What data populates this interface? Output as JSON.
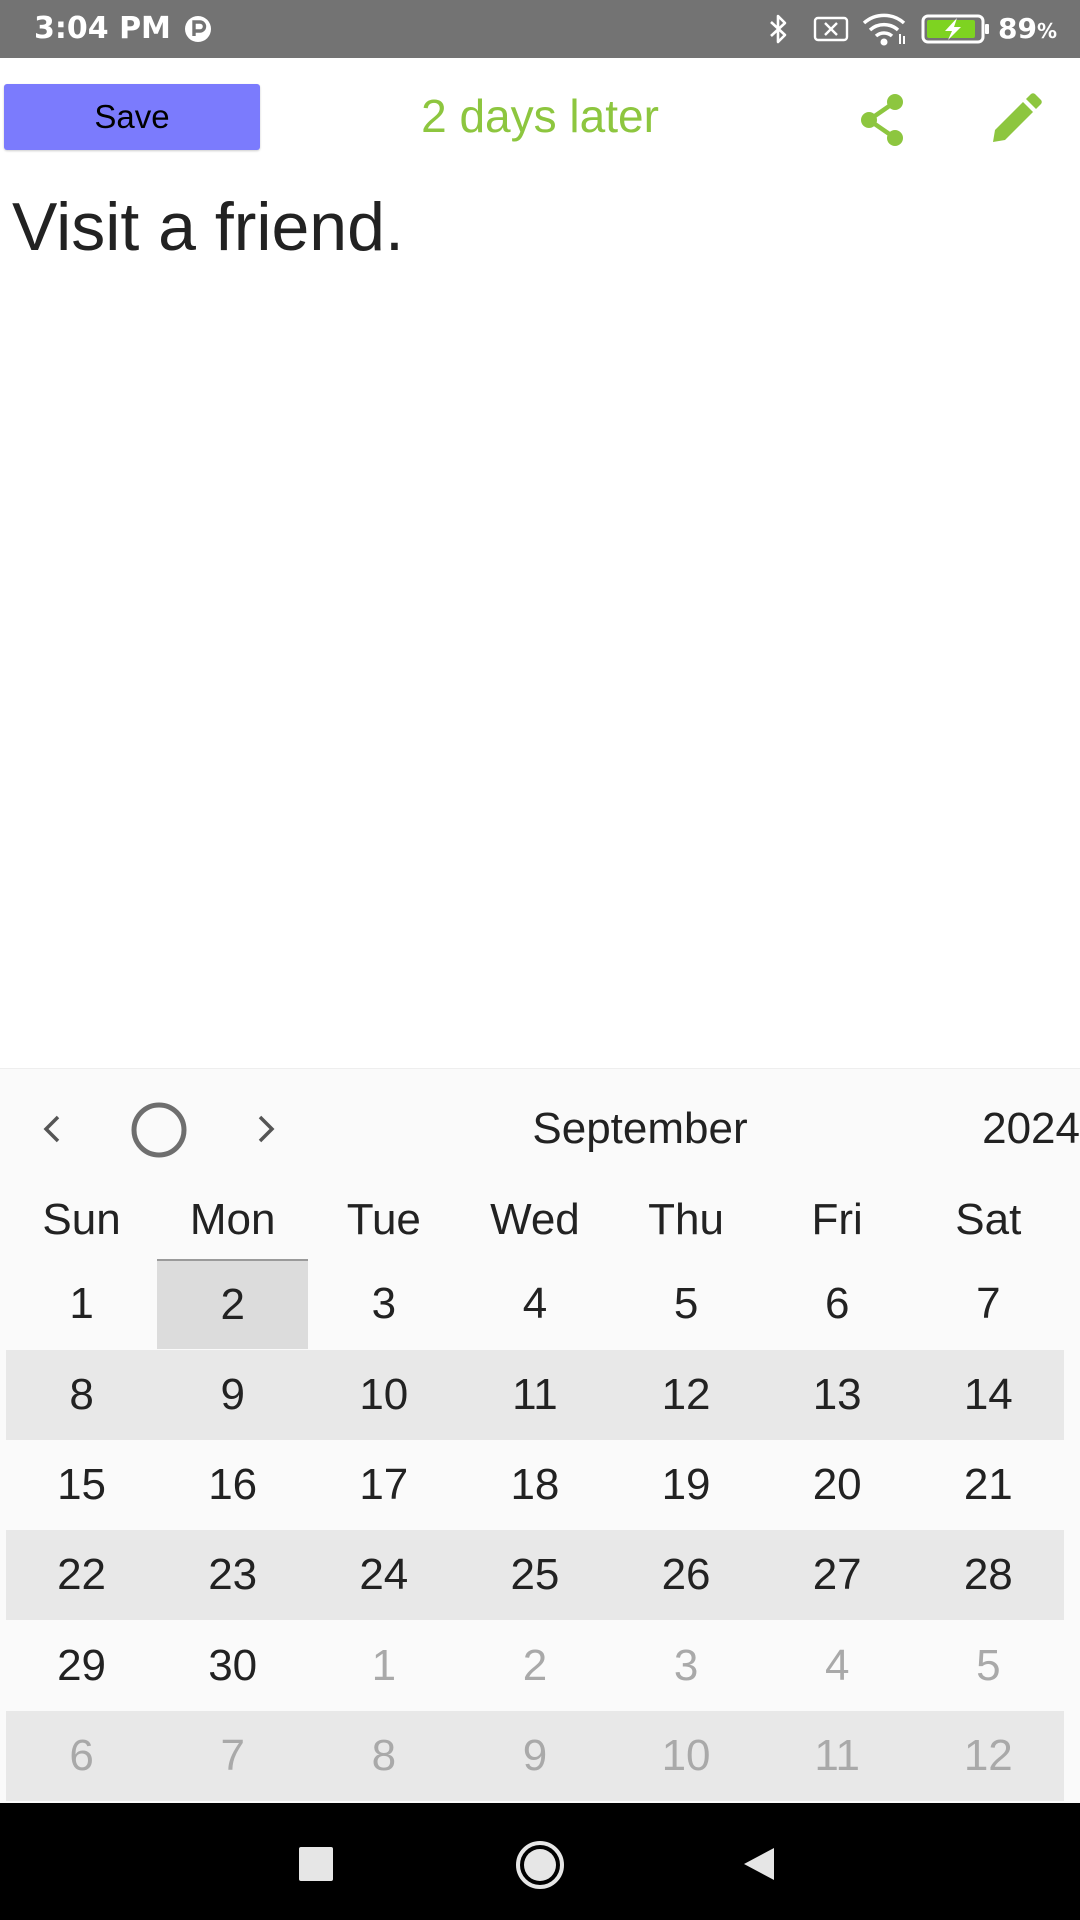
{
  "status_bar": {
    "time": "3:04 PM",
    "battery_value": "89",
    "battery_unit": "%",
    "icons": [
      "parking-icon",
      "bluetooth-icon",
      "no-sim-icon",
      "wifi-icon",
      "battery-charging-icon"
    ]
  },
  "toolbar": {
    "save_label": "Save",
    "title": "2 days later",
    "actions": [
      "share-icon",
      "edit-icon"
    ]
  },
  "note": {
    "text": "Visit a friend."
  },
  "calendar": {
    "month": "September",
    "year": "2024",
    "nav_icons": [
      "chevron-left-icon",
      "today-circle-icon",
      "chevron-right-icon"
    ],
    "weekdays": [
      "Sun",
      "Mon",
      "Tue",
      "Wed",
      "Thu",
      "Fri",
      "Sat"
    ],
    "selected_day": "2",
    "weeks": [
      [
        "1",
        "2",
        "3",
        "4",
        "5",
        "6",
        "7"
      ],
      [
        "8",
        "9",
        "10",
        "11",
        "12",
        "13",
        "14"
      ],
      [
        "15",
        "16",
        "17",
        "18",
        "19",
        "20",
        "21"
      ],
      [
        "22",
        "23",
        "24",
        "25",
        "26",
        "27",
        "28"
      ],
      [
        "29",
        "30",
        "1",
        "2",
        "3",
        "4",
        "5"
      ],
      [
        "6",
        "7",
        "8",
        "9",
        "10",
        "11",
        "12"
      ]
    ]
  },
  "nav_bar": {
    "buttons": [
      "recents-icon",
      "home-icon",
      "back-icon"
    ]
  },
  "colors": {
    "accent": "#8dc63f",
    "save_button": "#7b7bfd",
    "status_bar": "#737373",
    "week_shade": "#e8e8e8",
    "selected_day": "#dcdcdc",
    "other_month_text": "#a9a9a9"
  }
}
